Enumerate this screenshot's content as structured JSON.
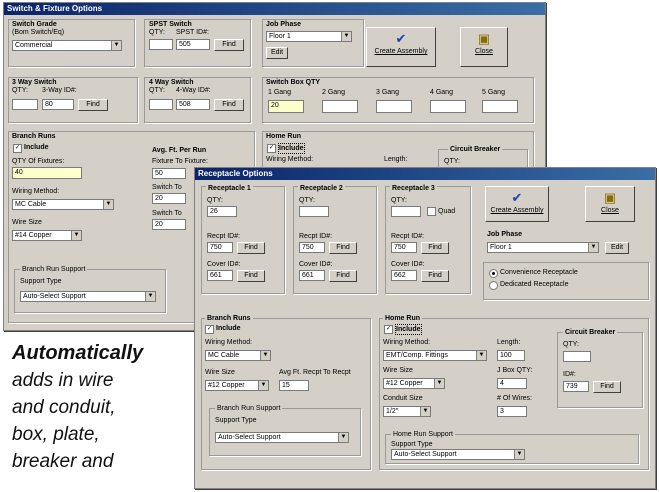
{
  "back": {
    "title": "Switch & Fixture Options",
    "switch_grade_label": "Switch Grade",
    "switch_grade_sub": "(Bom Switch/Eq)",
    "switch_grade_value": "Commercial",
    "spst_label": "SPST Switch",
    "spst_qty_label": "QTY:",
    "spst_id_label": "SPST ID#:",
    "spst_qty": "",
    "spst_id": "505",
    "find": "Find",
    "job_phase_label": "Job Phase",
    "job_phase_value": "Floor 1",
    "edit": "Edit",
    "create_assembly": "Create Assembly",
    "close": "Close",
    "threeway_label": "3 Way Switch",
    "threeway_qty_label": "QTY:",
    "threeway_id_label": "3-Way ID#:",
    "threeway_id": "80",
    "fourway_label": "4 Way Switch",
    "fourway_qty_label": "QTY:",
    "fourway_id_label": "4-Way ID#:",
    "fourway_id": "508",
    "switch_box_label": "Switch Box QTY",
    "gangs": [
      "1 Gang",
      "2 Gang",
      "3 Gang",
      "4 Gang",
      "5 Gang"
    ],
    "gang1_value": "20",
    "branch_runs_label": "Branch Runs",
    "include": "Include",
    "qty_fixtures_label": "QTY Of Fixtures:",
    "qty_fixtures": "40",
    "wiring_method_label": "Wiring Method:",
    "wiring_method": "MC Cable",
    "wire_size_label": "Wire Size",
    "wire_size": "#14 Copper",
    "avg_ft_label": "Avg. Ft. Per Run",
    "fixture_to_fixture_label": "Fixture To Fixture:",
    "fixture_to_fixture": "50",
    "switch_to_1": "Switch To",
    "switch_to_1_val": "20",
    "switch_to_2": "Switch To",
    "switch_to_2_val": "20",
    "branch_support_label": "Branch Run Support",
    "support_type_label": "Support Type",
    "support_type": "Auto-Select Support",
    "home_run_label": "Home Run",
    "home_wiring_label": "Wiring Method:",
    "length_label": "Length:",
    "breaker_label": "Circuit Breaker",
    "breaker_qty_label": "QTY:"
  },
  "front": {
    "title": "Receptacle Options",
    "rec1_label": "Receptacle 1",
    "rec2_label": "Receptacle 2",
    "rec3_label": "Receptacle 3",
    "qty_label": "QTY:",
    "rec1_qty": "26",
    "rec2_qty": "",
    "rec3_qty": "",
    "quad": "Quad",
    "recpt_id_label": "Recpt ID#:",
    "rec1_id": "750",
    "rec2_id": "750",
    "rec3_id": "750",
    "cover_id_label": "Cover ID#:",
    "rec1_cover": "661",
    "rec2_cover": "661",
    "rec3_cover": "662",
    "find": "Find",
    "create_assembly": "Create Assembly",
    "close": "Close",
    "job_phase_label": "Job Phase",
    "job_phase_value": "Floor 1",
    "edit": "Edit",
    "radio1": "Convenience Receptacle",
    "radio2": "Dedicated Receptacle",
    "branch_runs_label": "Branch Runs",
    "include": "Include",
    "wiring_method_label": "Wiring Method:",
    "wiring_method": "MC Cable",
    "wire_size_label": "Wire Size",
    "wire_size": "#12 Copper",
    "avg_ft_label": "Avg Ft. Recpt To Recpt",
    "avg_ft": "15",
    "branch_support_label": "Branch Run Support",
    "support_type_label": "Support Type",
    "support_type": "Auto-Select Support",
    "home_run_label": "Home Run",
    "home_include": "Include",
    "home_wiring_label": "Wiring Method:",
    "home_wiring": "EMT/Comp. Fittings",
    "length_label": "Length:",
    "length_value": "100",
    "home_wire_size_label": "Wire Size",
    "home_wire_size": "#12 Copper",
    "jbox_label": "J Box QTY:",
    "jbox_value": "4",
    "conduit_size_label": "Conduit Size",
    "conduit_size": "1/2\"",
    "ofwires_label": "# Of Wires:",
    "ofwires_value": "3",
    "home_support_label": "Home Run Support",
    "home_support_type_label": "Support Type",
    "home_support_type": "Auto-Select Support",
    "breaker_label": "Circuit Breaker",
    "breaker_qty_label": "QTY:",
    "breaker_qty": "",
    "breaker_id_label": "ID#:",
    "breaker_id": "739"
  },
  "caption": {
    "bold": "Automatically",
    "lines": [
      "adds in wire",
      "and conduit,",
      "box, plate,",
      "breaker and"
    ]
  },
  "icons": {
    "check": "checkmark-icon",
    "close": "door-icon",
    "arrow": "dropdown-arrow-icon"
  }
}
